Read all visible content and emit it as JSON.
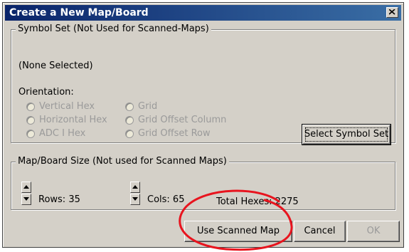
{
  "window": {
    "title": "Create a New Map/Board"
  },
  "symbol_set": {
    "legend": "Symbol Set  (Not Used for Scanned-Maps)",
    "selection": "(None Selected)",
    "orientation_label": "Orientation:",
    "options": [
      "Vertical Hex",
      "Horizontal Hex",
      "ADC I Hex",
      "Grid",
      "Grid Offset Column",
      "Grid Offset Row"
    ],
    "select_button": "Select Symbol Set"
  },
  "map_size": {
    "legend": "Map/Board Size  (Not used for Scanned Maps)",
    "rows_label": "Rows: 35",
    "cols_label": "Cols: 65",
    "total_label": "Total Hexes: 2275"
  },
  "buttons": {
    "use_scanned": "Use Scanned Map",
    "cancel": "Cancel",
    "ok": "OK"
  },
  "annotation_color": "#e8141e"
}
